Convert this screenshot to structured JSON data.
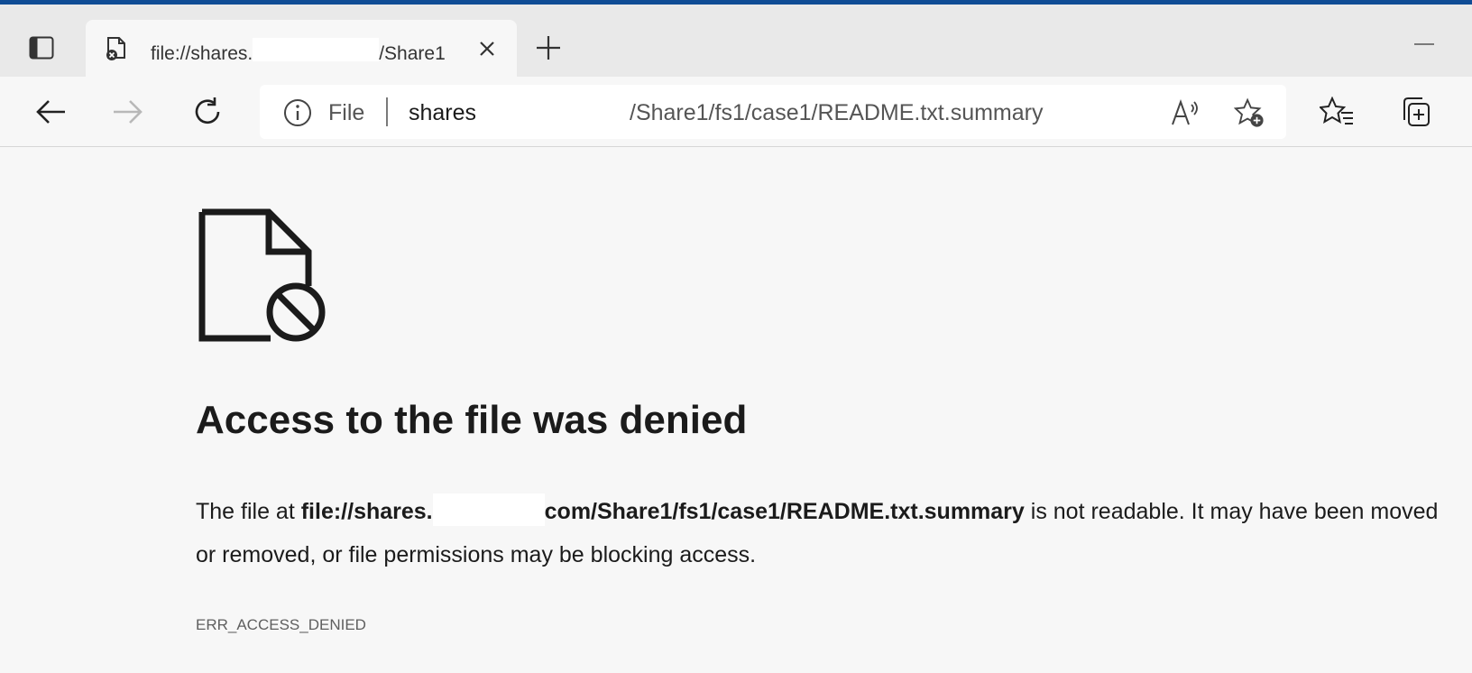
{
  "colors": {
    "accent": "#0f4c95",
    "tabstrip_bg": "#e9e9e9",
    "page_bg": "#f7f7f7",
    "text": "#1b1b1b"
  },
  "tab": {
    "title_prefix": "file://shares.",
    "title_suffix": "/Share1",
    "favicon": "file-blocked-icon"
  },
  "addressbar": {
    "scheme": "File",
    "host": "shares",
    "path": "/Share1/fs1/case1/README.txt.summary"
  },
  "toolbar": {
    "icons": [
      "back-arrow-icon",
      "forward-arrow-icon",
      "refresh-icon",
      "read-aloud-icon",
      "add-favorite-icon",
      "favorites-icon",
      "collections-icon"
    ]
  },
  "error": {
    "heading": "Access to the file was denied",
    "desc_prefix": "The file at ",
    "url_part1": "file://shares.",
    "url_part2": "com/Share1/fs1/case1/README.txt.summary",
    "desc_suffix": " is not readable. It may have been moved or removed, or file permissions may be blocking access.",
    "code": "ERR_ACCESS_DENIED"
  }
}
